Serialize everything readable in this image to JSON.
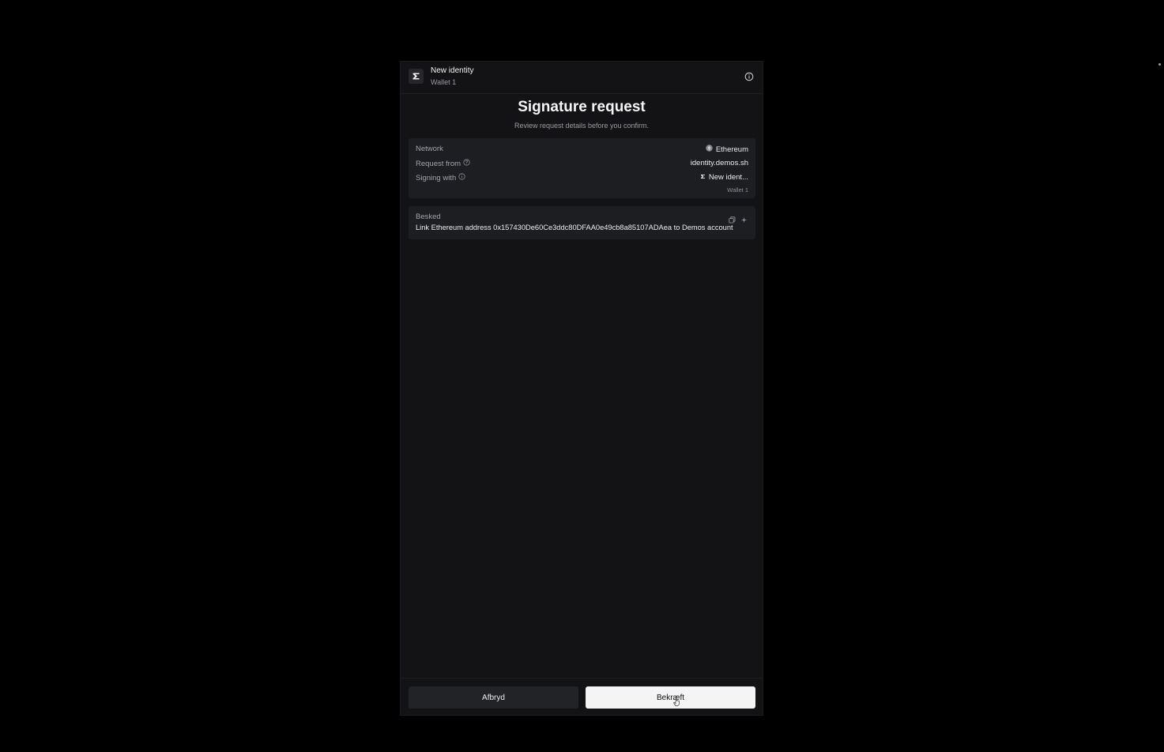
{
  "header": {
    "identity_name": "New identity",
    "wallet_name": "Wallet 1",
    "logo_icon": "sigma-logo-icon",
    "info_icon": "info-icon"
  },
  "title": "Signature request",
  "subtitle": "Review request details before you confirm.",
  "details": {
    "network_label": "Network",
    "network_value": "Ethereum",
    "request_from_label": "Request from",
    "request_from_value": "identity.demos.sh",
    "signing_with_label": "Signing with",
    "signing_with_value": "New ident...",
    "signing_with_sub": "Wallet 1"
  },
  "message": {
    "label": "Besked",
    "text": "Link Ethereum address 0x157430De60Ce3ddc80DFAA0e49cb8a85107ADAea to Demos account"
  },
  "buttons": {
    "cancel": "Afbryd",
    "confirm": "Bekræft"
  },
  "colors": {
    "background": "#000000",
    "panel": "#131316",
    "card": "#1d1e22",
    "confirm_button": "#f4f4f5"
  }
}
